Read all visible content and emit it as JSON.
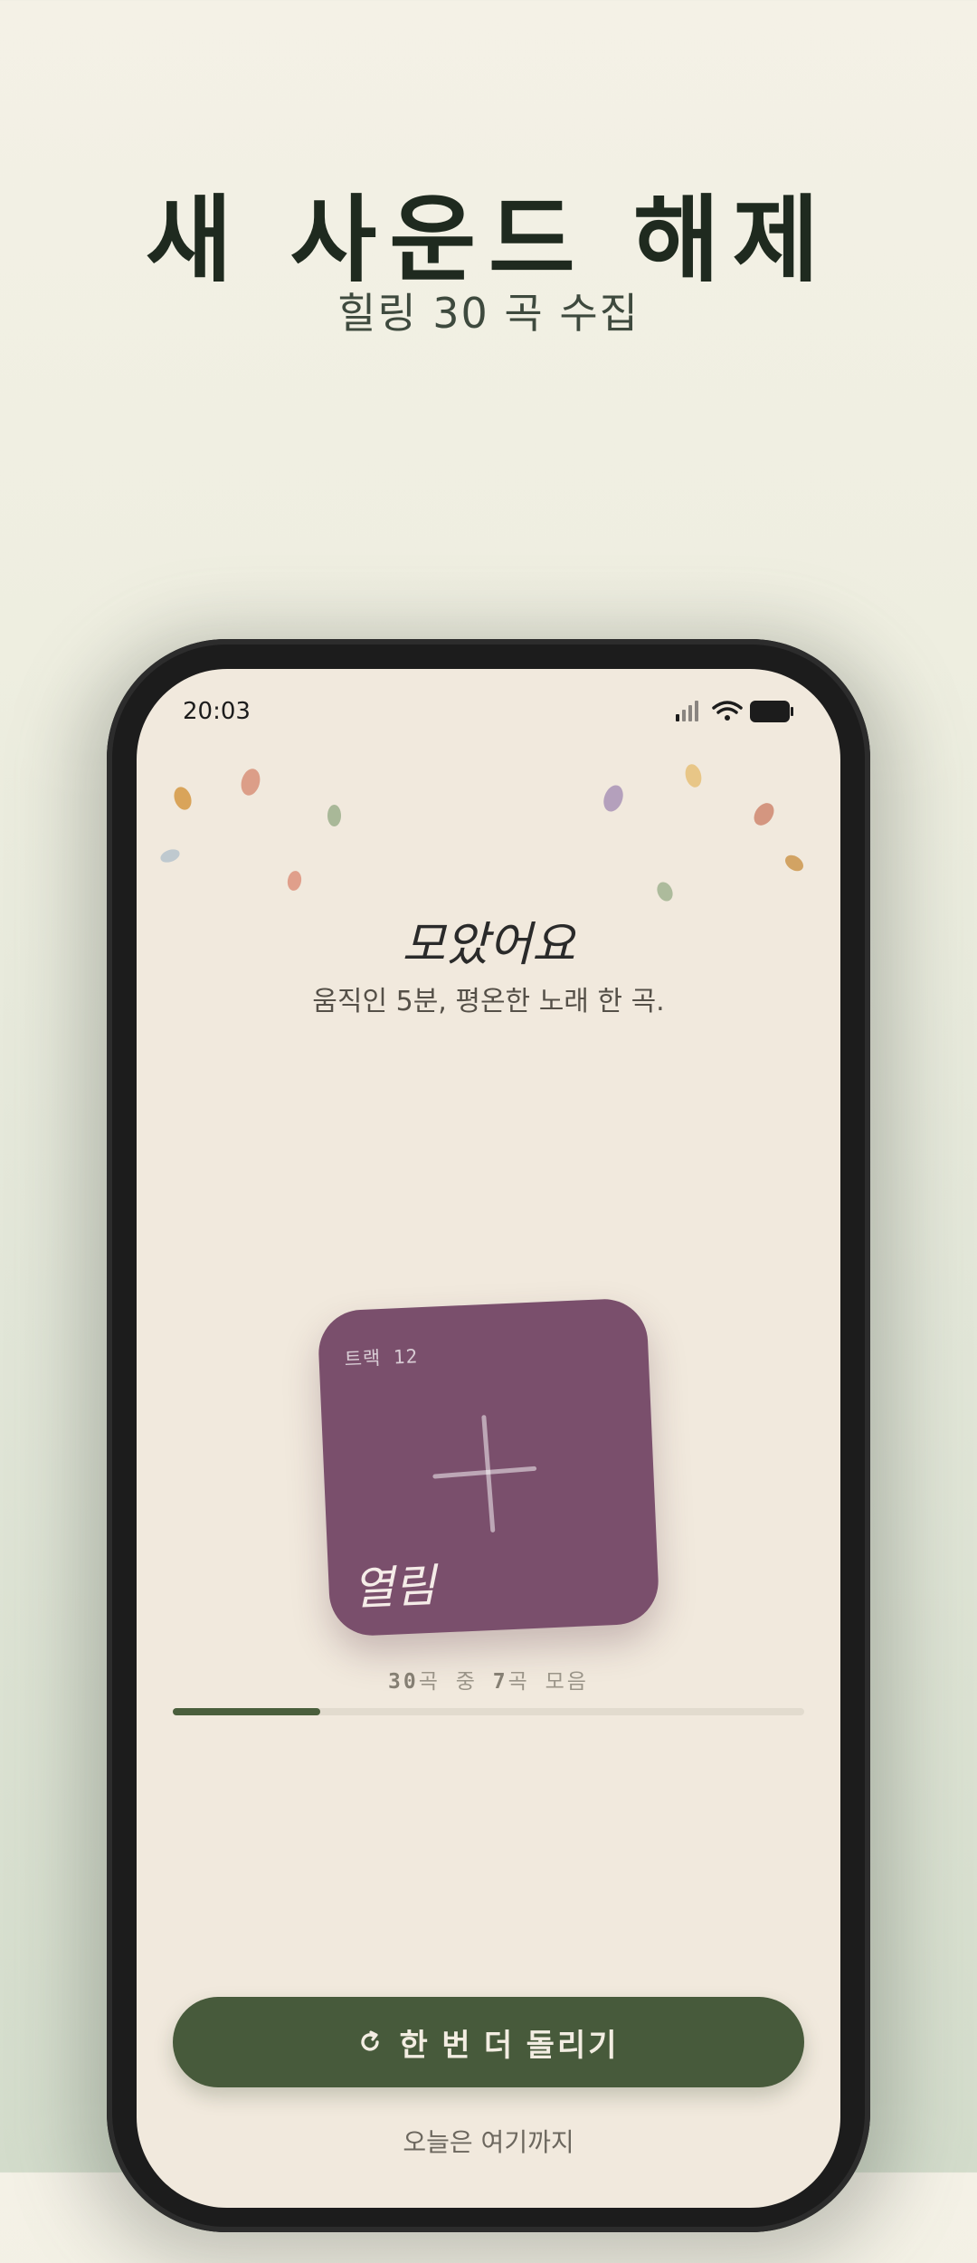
{
  "hero": {
    "title": "새 사운드 해제",
    "subtitle": "힐링 30 곡 수집"
  },
  "status_bar": {
    "time": "20:03",
    "icons": [
      "signal-icon",
      "wifi-icon",
      "battery-icon"
    ]
  },
  "result": {
    "title": "모았어요",
    "subtitle": "움직인 5분, 평온한 노래 한 곡."
  },
  "track_card": {
    "label": "트랙 12",
    "name": "열림",
    "color": "#7a4f6c",
    "icon": "plus-icon"
  },
  "progress": {
    "total": "30",
    "total_suffix": "곡 중 ",
    "collected": "7",
    "collected_suffix": "곡 모음",
    "fraction": 0.233,
    "fill_color": "#4a5e3c"
  },
  "actions": {
    "spin_again_label": "한 번 더 돌리기",
    "spin_icon": "refresh-icon",
    "done_label": "오늘은 여기까지"
  },
  "colors": {
    "accent": "#475a3b",
    "screen_bg": "#f1e9dd"
  }
}
